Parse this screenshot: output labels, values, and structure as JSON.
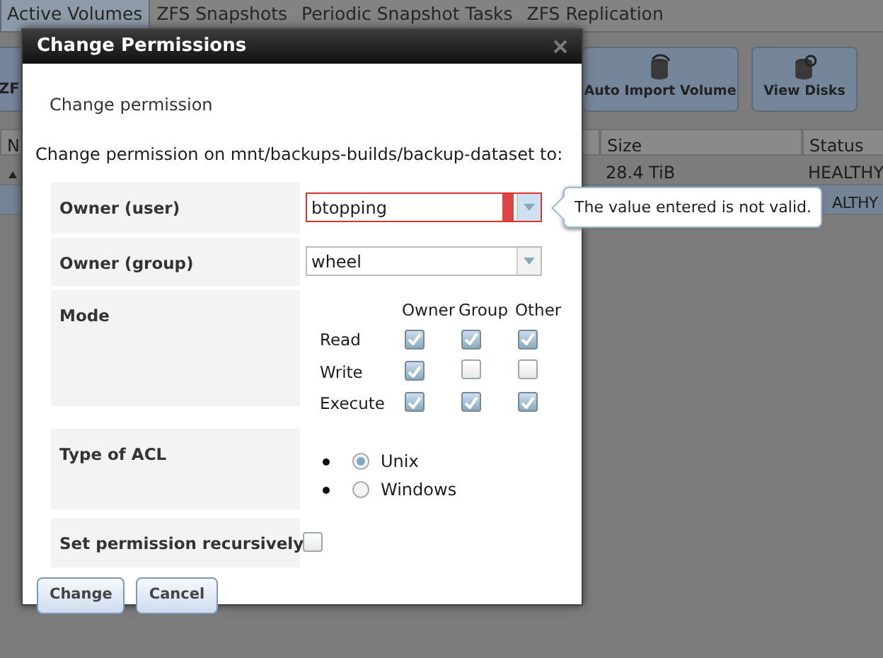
{
  "background": {
    "tabs": [
      {
        "label": "Active Volumes",
        "selected": true
      },
      {
        "label": "ZFS Snapshots",
        "selected": false
      },
      {
        "label": "Periodic Snapshot Tasks",
        "selected": false
      },
      {
        "label": "ZFS Replication",
        "selected": false
      }
    ],
    "toolbar_buttons": [
      {
        "label": "ZF",
        "kind": "cut"
      },
      {
        "label": "Auto Import Volume",
        "kind": "import"
      },
      {
        "label": "View Disks",
        "kind": "disks"
      }
    ],
    "table": {
      "columns": [
        "N",
        "Size",
        "Status"
      ],
      "rows": [
        {
          "expander": true,
          "size": "28.4 TiB",
          "status": "HEALTHY",
          "selected": false
        },
        {
          "expander": false,
          "status": "ALTHY",
          "selected": true
        }
      ]
    }
  },
  "dialog": {
    "title": "Change Permissions",
    "heading": "Change permission",
    "description": "Change permission on mnt/backups-builds/backup-dataset to:",
    "fields": [
      {
        "kind": "combo",
        "label": "Owner (user)",
        "value": "btopping",
        "invalid": true
      },
      {
        "kind": "combo",
        "label": "Owner (group)",
        "value": "wheel",
        "invalid": false
      },
      {
        "kind": "mode",
        "label": "Mode",
        "columns": [
          "Owner",
          "Group",
          "Other"
        ],
        "rows": [
          {
            "label": "Read",
            "checks": [
              true,
              true,
              true
            ]
          },
          {
            "label": "Write",
            "checks": [
              true,
              false,
              false
            ]
          },
          {
            "label": "Execute",
            "checks": [
              true,
              true,
              true
            ]
          }
        ]
      },
      {
        "kind": "radio",
        "label": "Type of ACL",
        "options": [
          {
            "label": "Unix",
            "selected": true
          },
          {
            "label": "Windows",
            "selected": false
          }
        ]
      },
      {
        "kind": "checkbox",
        "label": "Set permission recursively",
        "checked": false
      }
    ],
    "buttons": [
      "Change",
      "Cancel"
    ],
    "tooltip": "The value entered is not valid."
  }
}
